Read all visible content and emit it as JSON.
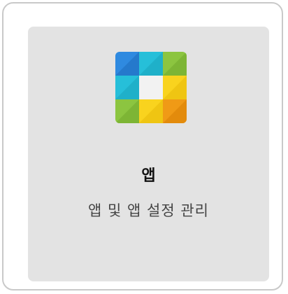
{
  "tile": {
    "icon": "apps-icon",
    "title": "앱",
    "subtitle": "앱 및 앱 설정 관리"
  },
  "colors": {
    "tile_background": "#e3e3e3",
    "frame_border": "#c9c9c9",
    "icon_blue": "#2f8ae0",
    "icon_cyan": "#26bfd9",
    "icon_green": "#8cc540",
    "icon_yellow": "#f9d31e",
    "icon_orange": "#f09a16",
    "icon_center": "#f2f2f2"
  }
}
